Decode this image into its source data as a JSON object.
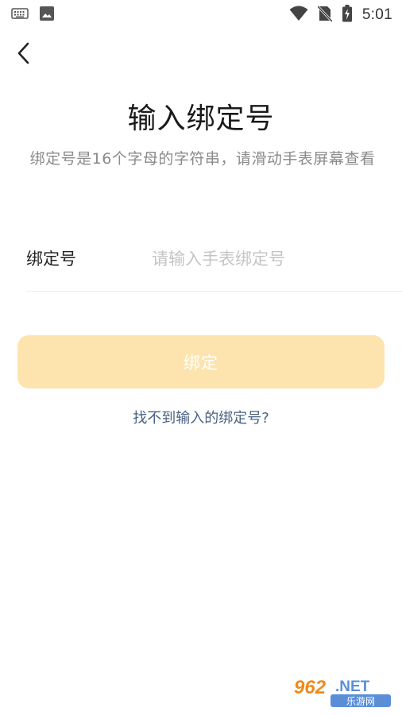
{
  "status_bar": {
    "time": "5:01",
    "left_icons": [
      "keyboard-icon",
      "image-icon"
    ],
    "right_icons": [
      "wifi-icon",
      "no-sim-icon",
      "battery-icon"
    ]
  },
  "nav": {
    "back_icon": "chevron-left-icon"
  },
  "header": {
    "title": "输入绑定号",
    "subtitle": "绑定号是16个字母的字符串，请滑动手表屏幕查看"
  },
  "form": {
    "label": "绑定号",
    "input_value": "",
    "input_placeholder": "请输入手表绑定号"
  },
  "actions": {
    "bind_label": "绑定",
    "help_link": "找不到输入的绑定号?"
  },
  "watermark": {
    "text_top": "962.NET",
    "text_bottom": "乐游网"
  },
  "colors": {
    "button_bg": "#fde4ae",
    "button_text": "#ffffff",
    "link": "#4a6283",
    "subtitle": "#8a8a8a",
    "placeholder": "#c4c4c4"
  }
}
